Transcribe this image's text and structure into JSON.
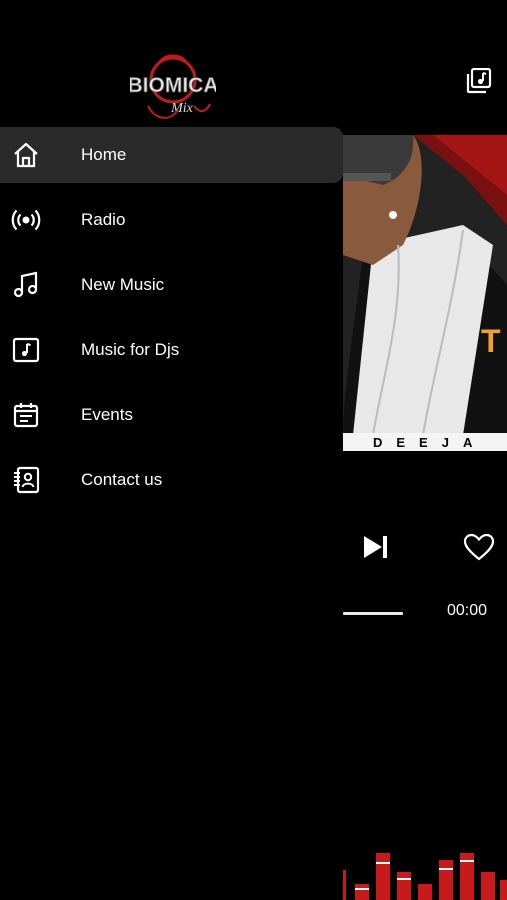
{
  "app": {
    "logo_text": "BIOMICA",
    "logo_sub": "Mix"
  },
  "menu": {
    "items": [
      {
        "label": "Home",
        "icon": "home-icon",
        "active": true
      },
      {
        "label": "Radio",
        "icon": "radio-broadcast-icon",
        "active": false
      },
      {
        "label": "New Music",
        "icon": "music-note-icon",
        "active": false
      },
      {
        "label": "Music for Djs",
        "icon": "music-square-icon",
        "active": false
      },
      {
        "label": "Events",
        "icon": "calendar-icon",
        "active": false
      },
      {
        "label": "Contact us",
        "icon": "contact-book-icon",
        "active": false
      }
    ]
  },
  "player": {
    "cover_strip_text": "DEEJA",
    "cover_word": "T",
    "time": "00:00",
    "progress": 0.0
  },
  "colors": {
    "background": "#000000",
    "active_item": "#2a2a2a",
    "accent": "#d42020"
  }
}
